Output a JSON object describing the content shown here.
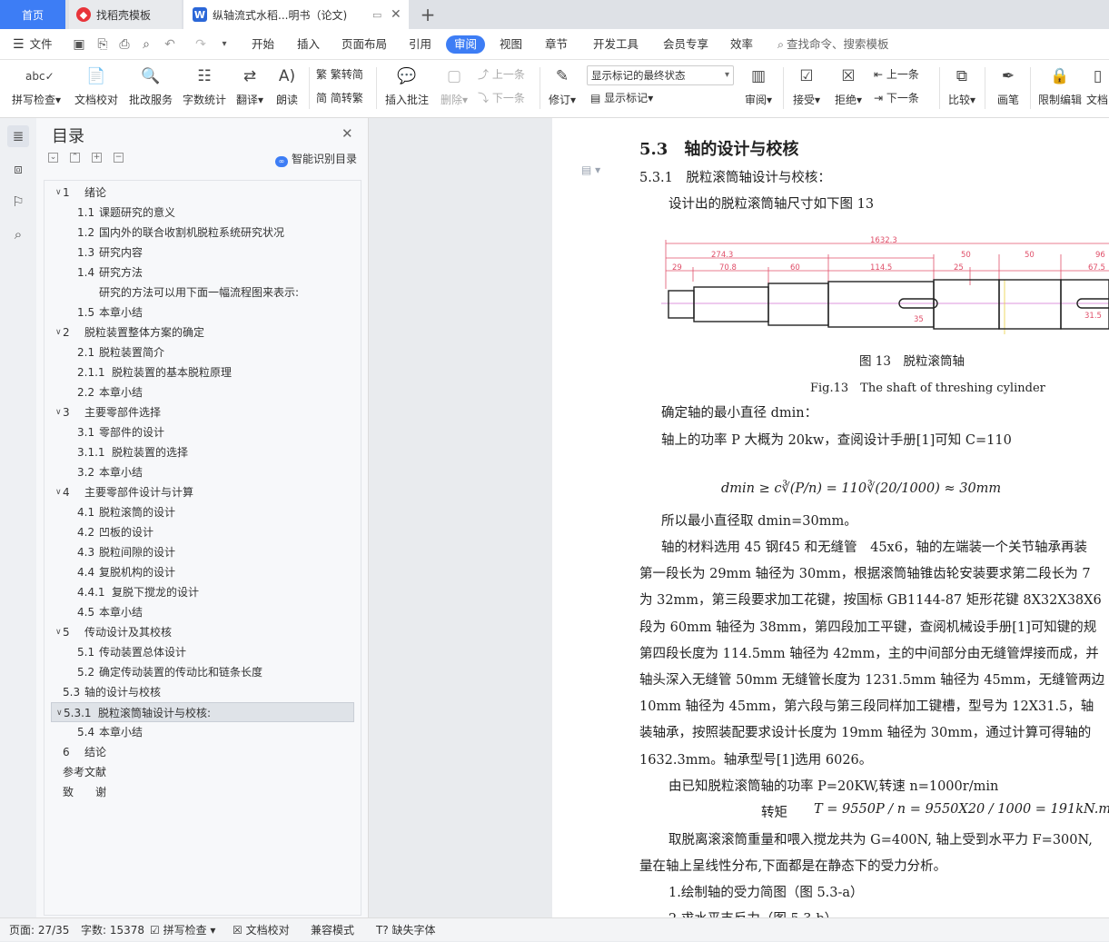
{
  "tabs": {
    "home": "首页",
    "template": "找稻壳模板",
    "document": "纵轴流式水稻...明书（论文)"
  },
  "menu": {
    "file": "文件",
    "items": [
      "开始",
      "插入",
      "页面布局",
      "引用",
      "审阅",
      "视图",
      "章节",
      "开发工具",
      "会员专享",
      "效率"
    ],
    "active": "审阅",
    "search": "查找命令、搜索模板"
  },
  "ribbon": {
    "spell_check": "拼写检查",
    "doc_proof": "文档校对",
    "batch_service": "批改服务",
    "word_count": "字数统计",
    "translate": "翻译",
    "read_aloud": "朗读",
    "trad": "繁转简",
    "simp": "简转繁",
    "insert_comment": "插入批注",
    "delete": "删除",
    "prev": "上一条",
    "next": "下一条",
    "track": "修订",
    "show_state": "显示标记的最终状态",
    "show_marks": "显示标记",
    "review": "审阅",
    "accept": "接受",
    "reject": "拒绝",
    "prev2": "上一条",
    "next2": "下一条",
    "compare": "比较",
    "pen": "画笔",
    "restrict": "限制编辑",
    "doc_more": "文档"
  },
  "toc": {
    "title": "目录",
    "smart": "智能识别目录",
    "items": [
      {
        "num": "1",
        "text": "绪论",
        "level": 1,
        "expand": true
      },
      {
        "num": "1.1",
        "text": "课题研究的意义",
        "level": 2
      },
      {
        "num": "1.2",
        "text": "国内外的联合收割机脱粒系统研究状况",
        "level": 2
      },
      {
        "num": "1.3",
        "text": "研究内容",
        "level": 2
      },
      {
        "num": "1.4",
        "text": "研究方法",
        "level": 2
      },
      {
        "num": "",
        "text": "研究的方法可以用下面一幅流程图来表示:",
        "level": 3
      },
      {
        "num": "1.5",
        "text": "本章小结",
        "level": 2
      },
      {
        "num": "2",
        "text": "脱粒装置整体方案的确定",
        "level": 1,
        "expand": true
      },
      {
        "num": "2.1",
        "text": "脱粒装置简介",
        "level": 2
      },
      {
        "num": "2.1.1",
        "text": "脱粒装置的基本脱粒原理",
        "level": 2
      },
      {
        "num": "2.2",
        "text": "本章小结",
        "level": 2
      },
      {
        "num": "3",
        "text": "主要零部件选择",
        "level": 1,
        "expand": true
      },
      {
        "num": "3.1",
        "text": "零部件的设计",
        "level": 2
      },
      {
        "num": "3.1.1",
        "text": "脱粒装置的选择",
        "level": 2
      },
      {
        "num": "3.2",
        "text": "本章小结",
        "level": 2
      },
      {
        "num": "4",
        "text": "主要零部件设计与计算",
        "level": 1,
        "expand": true
      },
      {
        "num": "4.1",
        "text": "脱粒滚筒的设计",
        "level": 2
      },
      {
        "num": "4.2",
        "text": "凹板的设计",
        "level": 2
      },
      {
        "num": "4.3",
        "text": "脱粒间隙的设计",
        "level": 2
      },
      {
        "num": "4.4",
        "text": "复脱机构的设计",
        "level": 2
      },
      {
        "num": "4.4.1",
        "text": "复脱下搅龙的设计",
        "level": 2
      },
      {
        "num": "4.5",
        "text": "本章小结",
        "level": 2
      },
      {
        "num": "5",
        "text": "传动设计及其校核",
        "level": 1,
        "expand": true
      },
      {
        "num": "5.1",
        "text": "传动装置总体设计",
        "level": 2
      },
      {
        "num": "5.2",
        "text": "确定传动装置的传动比和链条长度",
        "level": 2
      },
      {
        "num": "5.3",
        "text": "轴的设计与校核",
        "level": 1
      },
      {
        "num": "5.3.1",
        "text": "脱粒滚筒轴设计与校核:",
        "level": 1,
        "expand": true,
        "selected": true
      },
      {
        "num": "5.4",
        "text": "本章小结",
        "level": 2
      },
      {
        "num": "6",
        "text": "结论",
        "level": 1
      },
      {
        "num": "",
        "text": "参考文献",
        "level": 0
      },
      {
        "num": "",
        "text": "致　　谢",
        "level": 0
      }
    ]
  },
  "document": {
    "heading": "5.3　轴的设计与校核",
    "subheading": "5.3.1　脱粒滚筒轴设计与校核：",
    "intro": "设计出的脱粒滚筒轴尺寸如下图 13",
    "figure": {
      "dims": [
        "1632.3",
        "274.3",
        "50",
        "50",
        "96",
        "29",
        "70.8",
        "60",
        "114.5",
        "25",
        "67.5",
        "35",
        "31.5"
      ],
      "caption_cn": "图 13　脱粒滚筒轴",
      "caption_en": "Fig.13　The shaft of threshing cylinder"
    },
    "line1": "确定轴的最小直径 dmin：",
    "line2": "轴上的功率 P 大概为 20kw，查阅设计手册[1]可知 C=110",
    "formula1": "dmin ≥ c∛(P/n) = 110∛(20/1000) ≈ 30mm",
    "line3": "所以最小直径取 dmin=30mm。",
    "para": [
      "轴的材料选用 45 钢f45 和无缝管　45x6，轴的左端装一个关节轴承再装",
      "第一段长为 29mm 轴径为 30mm，根据滚筒轴锥齿轮安装要求第二段长为 7",
      "为 32mm，第三段要求加工花键，按国标 GB1144-87 矩形花键 8X32X38X6",
      "段为 60mm 轴径为 38mm，第四段加工平键，查阅机械设手册[1]可知键的规",
      "第四段长度为 114.5mm 轴径为 42mm，主的中间部分由无缝管焊接而成，并",
      "轴头深入无缝管 50mm 无缝管长度为 1231.5mm 轴径为 45mm，无缝管两边",
      "10mm 轴径为 45mm，第六段与第三段同样加工键槽，型号为 12X31.5，轴",
      "装轴承，按照装配要求设计长度为 19mm 轴径为 30mm，通过计算可得轴的",
      "1632.3mm。轴承型号[1]选用 6026。"
    ],
    "line4": "由已知脱粒滚筒轴的功率 P=20KW,转速 n=1000r/min",
    "torque_label": "转矩",
    "formula2": "T = 9550P / n = 9550X20 / 1000 = 191kN.m",
    "line5": "取脱离滚滚筒重量和喂入搅龙共为 G=400N, 轴上受到水平力 F=300N,",
    "line6": "量在轴上呈线性分布,下面都是在静态下的受力分析。",
    "line7": "1.绘制轴的受力简图（图 5.3-a）",
    "line8": "2.求水平支反力（图 5.3-b）"
  },
  "status": {
    "page": "页面: 27/35",
    "words": "字数: 15378",
    "spell": "拼写检查",
    "proof": "文档校对",
    "compat": "兼容模式",
    "font_missing": "缺失字体"
  },
  "colors": {
    "accent": "#3d7df5",
    "cad_dim": "#e0506a"
  }
}
